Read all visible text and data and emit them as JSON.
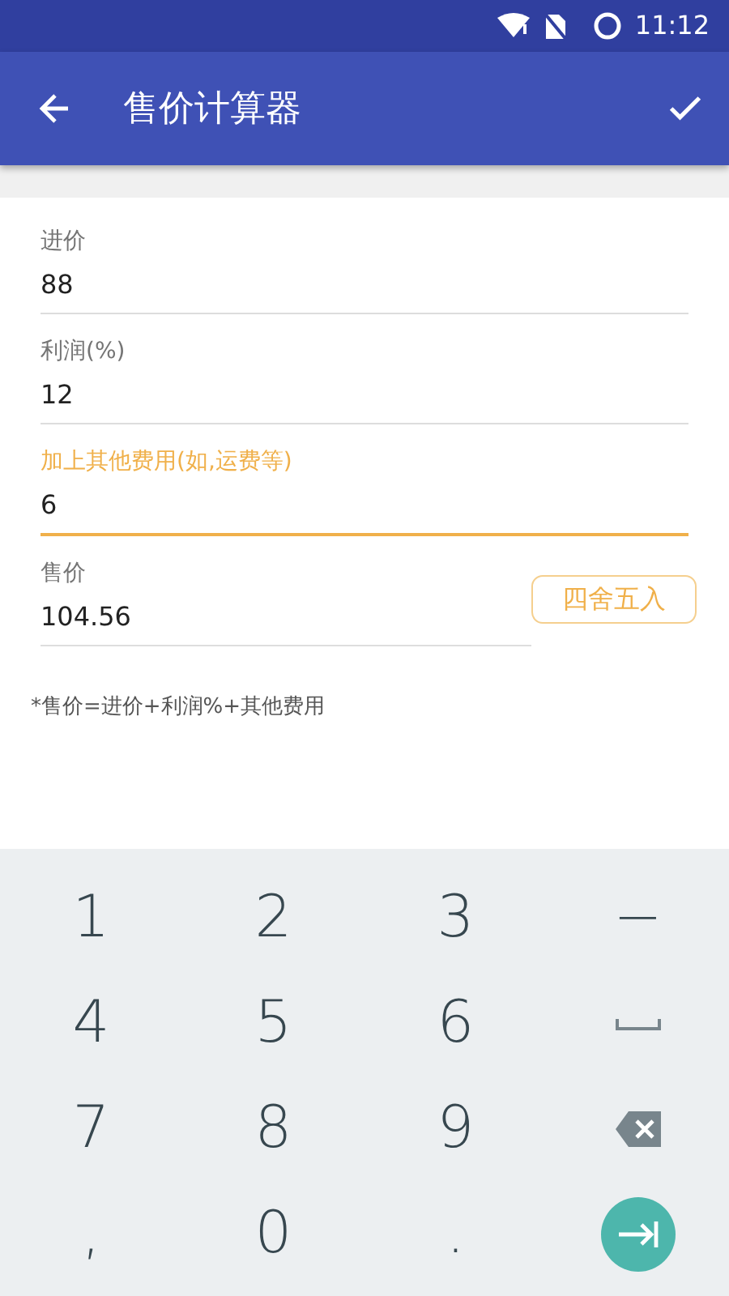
{
  "status_bar": {
    "time": "11:12"
  },
  "app_bar": {
    "title": "售价计算器"
  },
  "fields": [
    {
      "label": "进价",
      "value": "88",
      "focused": false
    },
    {
      "label": "利润(%)",
      "value": "12",
      "focused": false
    },
    {
      "label": "加上其他费用(如,运费等)",
      "value": "6",
      "focused": true
    },
    {
      "label": "售价",
      "value": "104.56",
      "focused": false,
      "action": "四舍五入"
    }
  ],
  "note": "*售价=进价+利润%+其他费用",
  "keyboard": [
    {
      "kind": "text",
      "label": "1"
    },
    {
      "kind": "text",
      "label": "2"
    },
    {
      "kind": "text",
      "label": "3"
    },
    {
      "kind": "text",
      "label": "−"
    },
    {
      "kind": "text",
      "label": "4"
    },
    {
      "kind": "text",
      "label": "5"
    },
    {
      "kind": "text",
      "label": "6"
    },
    {
      "kind": "space"
    },
    {
      "kind": "text",
      "label": "7"
    },
    {
      "kind": "text",
      "label": "8"
    },
    {
      "kind": "text",
      "label": "9"
    },
    {
      "kind": "backspace"
    },
    {
      "kind": "text",
      "label": ","
    },
    {
      "kind": "text",
      "label": "0"
    },
    {
      "kind": "text",
      "label": "."
    },
    {
      "kind": "next"
    }
  ]
}
